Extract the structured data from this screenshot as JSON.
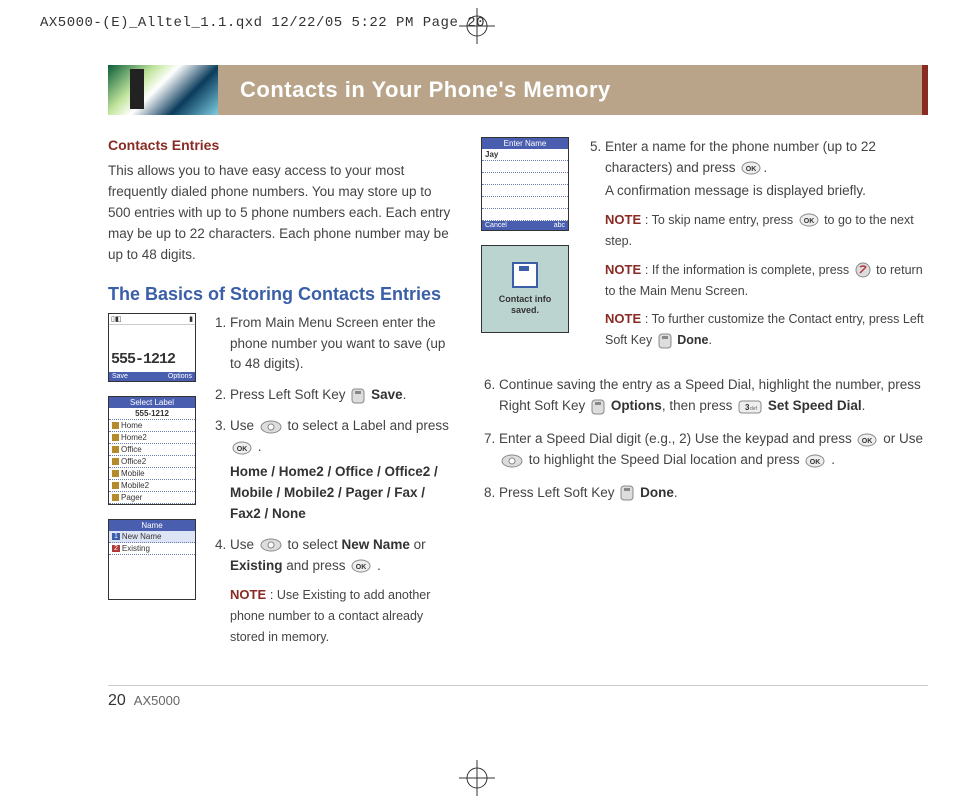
{
  "crop_line": "AX5000-(E)_Alltel_1.1.qxd  12/22/05  5:22 PM  Page 20",
  "title": "Contacts in Your Phone's Memory",
  "section1": {
    "heading": "Contacts Entries",
    "para": "This allows you to have easy access to your most frequently dialed phone numbers. You may store up to 500 entries with up to 5 phone numbers each. Each entry may be up to 22 characters. Each phone number may be up to 48 digits."
  },
  "section2_heading": "The Basics of Storing Contacts Entries",
  "shotA": {
    "number": "555-1212",
    "soft_left": "Save",
    "soft_right": "Options"
  },
  "shotB": {
    "title": "Select Label",
    "num": "555-1212",
    "items": [
      "Home",
      "Home2",
      "Office",
      "Office2",
      "Mobile",
      "Mobile2",
      "Pager"
    ]
  },
  "shotC": {
    "title": "Name",
    "items": [
      "New Name",
      "Existing"
    ]
  },
  "shotD": {
    "title": "Enter Name",
    "value": "Jay",
    "soft_left": "Cancel",
    "soft_right": "abc"
  },
  "shotE": {
    "line1": "Contact info",
    "line2": "saved."
  },
  "steps_left": {
    "s1": "From Main Menu Screen enter the phone number you want to save (up to 48 digits).",
    "s2a": "Press Left Soft Key ",
    "s2b": "Save",
    "s3a": "Use ",
    "s3b": " to select a Label and press ",
    "s3_labels": "Home / Home2 / Office / Office2 / Mobile / Mobile2 / Pager / Fax / Fax2 / None",
    "s4a": "Use ",
    "s4b": " to select ",
    "s4c": "New Name",
    "s4d": " or ",
    "s4e": "Existing",
    "s4f": " and press ",
    "note4": "Use Existing to add another phone number to a contact already stored in memory."
  },
  "steps_right_top": {
    "s5a": "Enter a name for the phone number (up to 22 characters) and press ",
    "s5b": ".",
    "s5c": "A confirmation message is displayed briefly.",
    "note1a": "To skip name entry, press ",
    "note1b": " to go to the next step.",
    "note2a": "If the information is complete, press ",
    "note2b": " to return to the Main Menu Screen.",
    "note3a": "To further customize the Contact entry, press Left Soft Key ",
    "note3b": "Done"
  },
  "steps_right_bottom": {
    "s6a": "Continue saving the entry as a Speed Dial, highlight the number, press Right Soft Key ",
    "s6b": "Options",
    "s6c": ", then press ",
    "s6d": "Set Speed Dial",
    "s7a": "Enter a Speed Dial digit (e.g., 2) Use the keypad and press ",
    "s7b": " or Use ",
    "s7c": " to highlight the Speed Dial location and press ",
    "s8a": "Press Left Soft Key ",
    "s8b": "Done"
  },
  "note_label": "NOTE",
  "footer": {
    "page_no": "20",
    "model": "AX5000"
  },
  "icons": {
    "ok": "OK",
    "softkey": "softkey",
    "nav": "nav",
    "end": "end",
    "key3": "3def"
  }
}
